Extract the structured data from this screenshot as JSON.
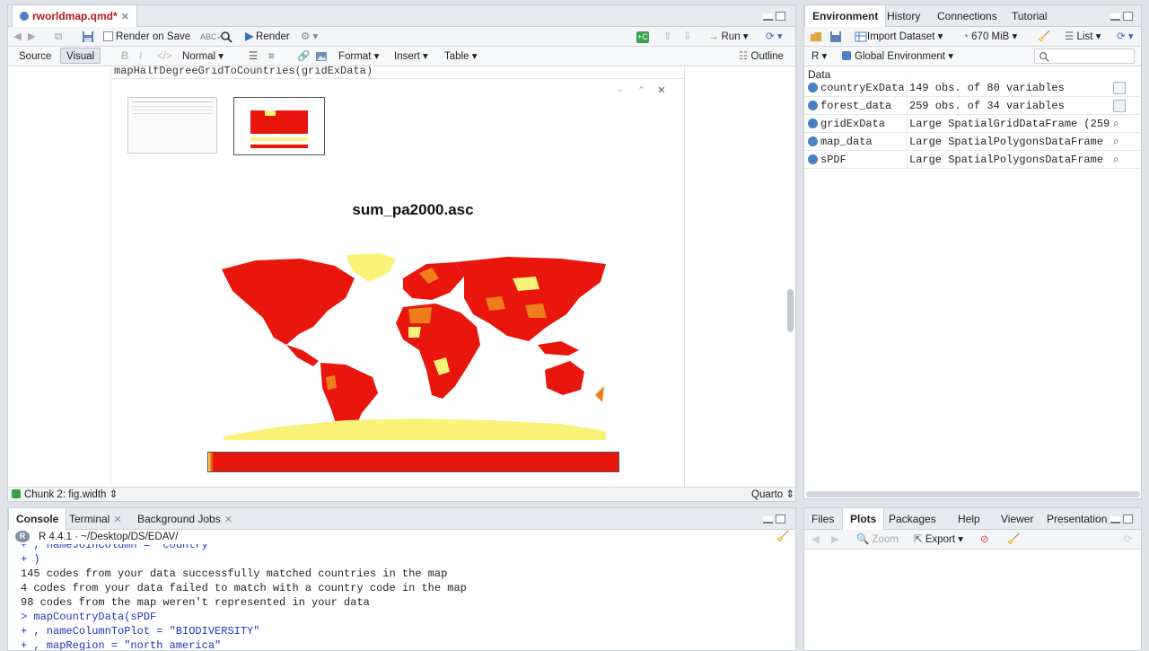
{
  "source_pane": {
    "file_tab": "rworldmap.qmd*",
    "toolbar": {
      "render_on_save": "Render on Save",
      "render": "Render",
      "run": "Run"
    },
    "format_bar": {
      "source": "Source",
      "visual": "Visual",
      "normal": "Normal",
      "format": "Format",
      "insert": "Insert",
      "table": "Table",
      "outline": "Outline"
    },
    "code_line": "mapHalfDegreeGridToCountries(gridExData)",
    "plot_title": "sum_pa2000.asc",
    "status": {
      "chunk": "Chunk 2: fig.width",
      "mode": "Quarto"
    }
  },
  "env_pane": {
    "tabs": [
      "Environment",
      "History",
      "Connections",
      "Tutorial"
    ],
    "toolbar": {
      "import": "Import Dataset",
      "memory": "670 MiB",
      "list": "List"
    },
    "lang": "R",
    "scope": "Global Environment",
    "section": "Data",
    "rows": [
      {
        "name": "countryExData",
        "value": "149 obs. of 80 variables"
      },
      {
        "name": "forest_data",
        "value": "259 obs. of 34 variables"
      },
      {
        "name": "gridExData",
        "value": "Large SpatialGridDataFrame (2592…"
      },
      {
        "name": "map_data",
        "value": "Large SpatialPolygonsDataFrame (…"
      },
      {
        "name": "sPDF",
        "value": "Large SpatialPolygonsDataFrame (…"
      }
    ]
  },
  "console_pane": {
    "tabs": [
      "Console",
      "Terminal",
      "Background Jobs"
    ],
    "version": "R 4.4.1 · ~/Desktop/DS/EDAV/",
    "lines": [
      {
        "prefix": "+",
        "text": "                        , nameJoinColumn = \"country\""
      },
      {
        "prefix": "+",
        "text": "                        )"
      },
      {
        "prefix": "",
        "text": "145 codes from your data successfully matched countries in the map"
      },
      {
        "prefix": "",
        "text": "4 codes from your data failed to match with a country code in the map"
      },
      {
        "prefix": "",
        "text": "98 codes from the map weren't represented in your data"
      },
      {
        "prefix": ">",
        "text": " mapCountryData(sPDF"
      },
      {
        "prefix": "+",
        "text": "               , nameColumnToPlot = \"BIODIVERSITY\""
      },
      {
        "prefix": "+",
        "text": "               , mapRegion = \"north america\""
      }
    ]
  },
  "files_pane": {
    "tabs": [
      "Files",
      "Plots",
      "Packages",
      "Help",
      "Viewer",
      "Presentation"
    ],
    "toolbar": {
      "zoom": "Zoom",
      "export": "Export"
    }
  },
  "colors": {
    "map_red": "#e8160c",
    "map_orange": "#ef7d1e",
    "map_yellow": "#fbf27a",
    "accent_blue": "#4a7fc1"
  }
}
